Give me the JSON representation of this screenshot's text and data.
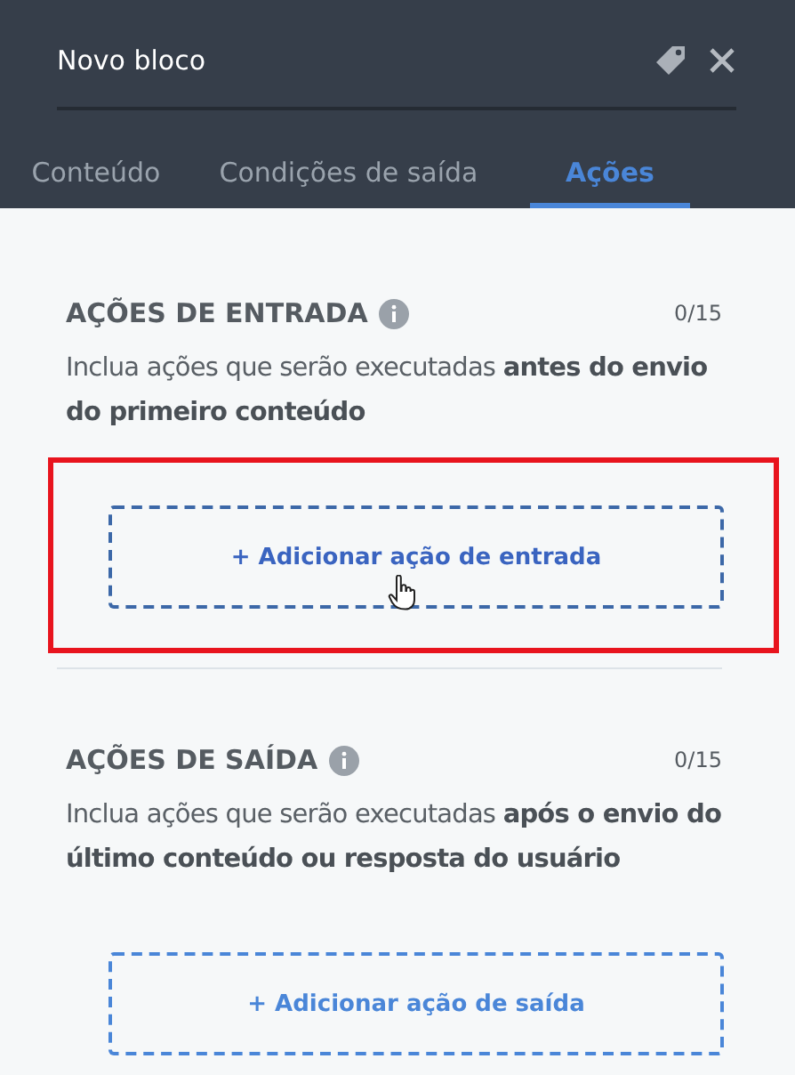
{
  "header": {
    "title": "Novo bloco"
  },
  "tabs": [
    {
      "label": "Conteúdo",
      "selected": false
    },
    {
      "label": "Condições de saída",
      "selected": false
    },
    {
      "label": "Ações",
      "selected": true
    }
  ],
  "sections": [
    {
      "heading": "AÇÕES DE ENTRADA",
      "count": "0/15",
      "description": "Inclua ações que serão executadas **antes do envio do primeiro conteúdo**",
      "button": "+ Adicionar ação de entrada",
      "hovered": true,
      "highlighted": true
    },
    {
      "heading": "AÇÕES DE SAÍDA",
      "count": "0/15",
      "description": "Inclua ações que serão executadas **após o envio do último conteúdo ou resposta do usuário**",
      "button": "+ Adicionar ação de saída",
      "hovered": false,
      "highlighted": false
    }
  ]
}
